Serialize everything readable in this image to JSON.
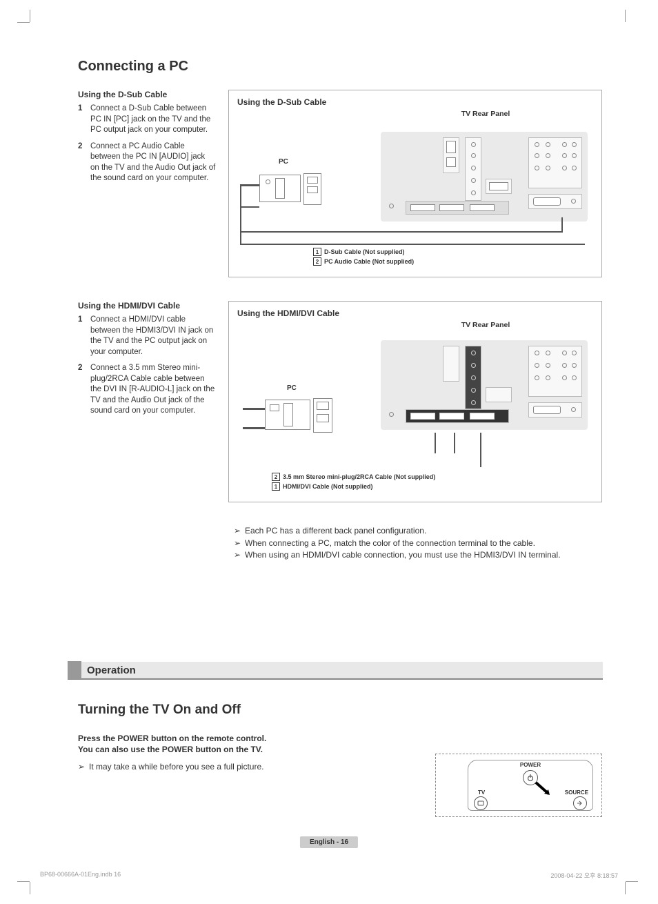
{
  "h1": "Connecting a PC",
  "dsub": {
    "title": "Using the D-Sub Cable",
    "step1_num": "1",
    "step1": "Connect a D-Sub Cable between PC IN [PC] jack on the TV and the PC output jack on your computer.",
    "step2_num": "2",
    "step2": "Connect a PC Audio Cable between the PC IN [AUDIO] jack on the TV and the Audio Out jack of the sound card on your computer."
  },
  "hdmi": {
    "title": "Using the HDMI/DVI Cable",
    "step1_num": "1",
    "step1": "Connect a HDMI/DVI cable between the HDMI3/DVI IN jack on the TV and the PC output jack on your computer.",
    "step2_num": "2",
    "step2": "Connect a 3.5 mm Stereo mini-plug/2RCA Cable cable between the DVI IN [R-AUDIO-L] jack on the TV and the Audio Out jack of the sound card on your computer."
  },
  "diagram1": {
    "title": "Using the D-Sub Cable",
    "panel": "TV Rear Panel",
    "pc": "PC",
    "legend1_num": "1",
    "legend1": "D-Sub Cable (Not supplied)",
    "legend2_num": "2",
    "legend2": "PC Audio Cable (Not supplied)"
  },
  "diagram2": {
    "title": "Using the HDMI/DVI Cable",
    "panel": "TV Rear Panel",
    "pc": "PC",
    "legend1_num": "1",
    "legend1": "HDMI/DVI Cable (Not supplied)",
    "legend2_num": "2",
    "legend2": "3.5 mm Stereo mini-plug/2RCA Cable (Not supplied)"
  },
  "notes": {
    "arrow": "➢",
    "n1": "Each PC has a different back panel configuration.",
    "n2": "When connecting a PC, match the color of the connection terminal to the cable.",
    "n3": "When using an HDMI/DVI cable connection, you must use the HDMI3/DVI IN terminal."
  },
  "section2": "Operation",
  "h2": "Turning the TV On and Off",
  "power": {
    "line1": "Press the POWER button on the remote control.",
    "line2": "You can also use the POWER button on the TV.",
    "note": "It may take a while before you see a full picture."
  },
  "remote": {
    "power": "POWER",
    "tv": "TV",
    "source": "SOURCE"
  },
  "footer": {
    "page": "English - 16",
    "left": "BP68-00666A-01Eng.indb   16",
    "right": "2008-04-22   오후 8:18:57"
  }
}
